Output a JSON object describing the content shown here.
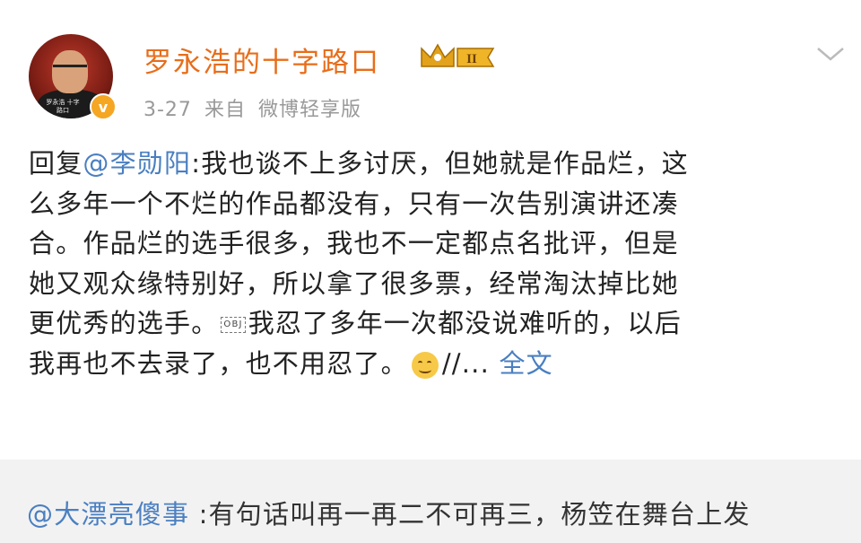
{
  "author": {
    "name": "罗永浩的十字路口",
    "avatar_caption": "罗永浩\n十字路口",
    "verified_mark": "v",
    "level_badge": "II"
  },
  "meta": {
    "date": "3-27",
    "source_prefix": "来自",
    "source": "微博轻享版"
  },
  "post": {
    "reply_prefix": "回复",
    "mention": "@李勋阳",
    "lines": [
      ":我也谈不上多讨厌，但她就是作品烂，这",
      "么多年一个不烂的作品都没有，只有一次告别演讲还凑",
      "合。作品烂的选手很多，我也不一定都点名批评，但是",
      "她又观众缘特别好，所以拿了很多票，经常淘汰掉比她",
      "更优秀的选手。"
    ],
    "obj_placeholder": "OBJ",
    "line5_rest": "我忍了多年一次都没说难听的，以后",
    "line6": "我再也不去录了，也不用忍了。",
    "after_emoji": "//...",
    "full_text_link": "全文"
  },
  "repost": {
    "mention": "@大漂亮傻事",
    "text": " :有句话叫再一再二不可再三，杨笠在舞台上发"
  },
  "icons": {
    "crown": "crown-level-icon",
    "chevron": "chevron-down-icon",
    "emoji": "smile-emoji-icon"
  }
}
